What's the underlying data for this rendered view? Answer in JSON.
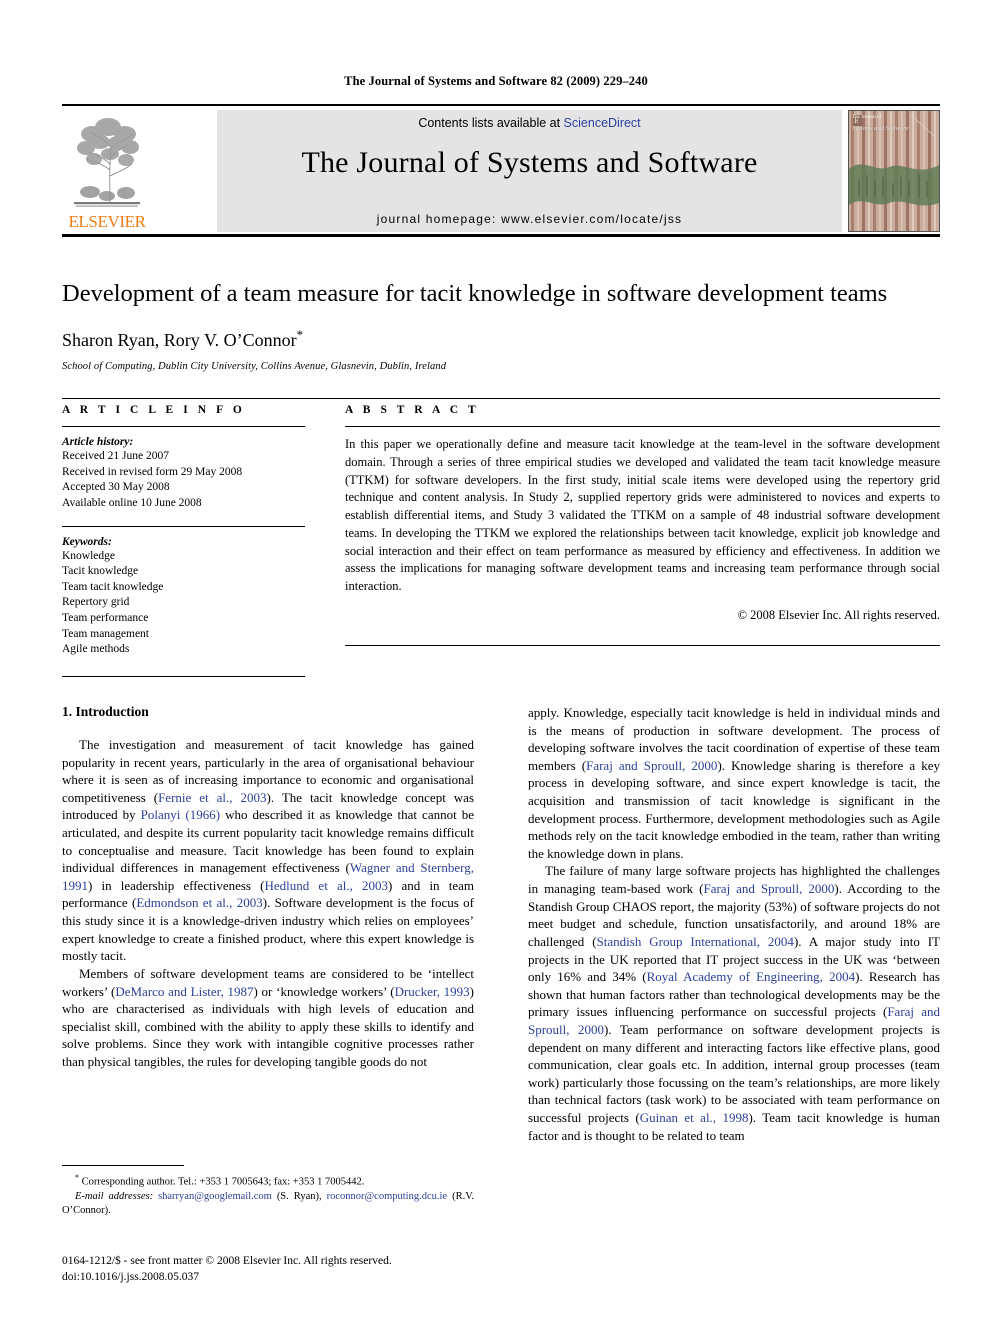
{
  "running_head": "The Journal of Systems and Software 82 (2009) 229–240",
  "masthead": {
    "contents_prefix": "Contents lists available at ",
    "sciencedirect": "ScienceDirect",
    "journal_title": "The Journal of Systems and Software",
    "homepage": "journal homepage: www.elsevier.com/locate/jss",
    "publisher_wordmark": "ELSEVIER",
    "cover": {
      "small_label": "The Journal of",
      "title": "Systems and Software"
    },
    "link_color": "#2a3fa0",
    "banner_bg": "#e4e4e4",
    "wordmark_color": "#f07c16"
  },
  "title_block": {
    "title": "Development of a team measure for tacit knowledge in software development teams",
    "authors": "Sharon Ryan, Rory V. O’Connor",
    "corresponding_marker": "*",
    "affiliation": "School of Computing, Dublin City University, Collins Avenue, Glasnevin, Dublin, Ireland"
  },
  "article_info": {
    "heading": "A R T I C L E    I N F O",
    "history_label": "Article history:",
    "history": [
      "Received 21 June 2007",
      "Received in revised form 29 May 2008",
      "Accepted 30 May 2008",
      "Available online 10 June 2008"
    ],
    "keywords_label": "Keywords:",
    "keywords": [
      "Knowledge",
      "Tacit knowledge",
      "Team tacit knowledge",
      "Repertory grid",
      "Team performance",
      "Team management",
      "Agile methods"
    ]
  },
  "abstract": {
    "heading": "A B S T R A C T",
    "text": "In this paper we operationally define and measure tacit knowledge at the team-level in the software development domain. Through a series of three empirical studies we developed and validated the team tacit knowledge measure (TTKM) for software developers. In the first study, initial scale items were developed using the repertory grid technique and content analysis. In Study 2, supplied repertory grids were administered to novices and experts to establish differential items, and Study 3 validated the TTKM on a sample of 48 industrial software development teams. In developing the TTKM we explored the relationships between tacit knowledge, explicit job knowledge and social interaction and their effect on team performance as measured by efficiency and effectiveness. In addition we assess the implications for managing software development teams and increasing team performance through social interaction.",
    "copyright": "© 2008 Elsevier Inc. All rights reserved."
  },
  "body": {
    "section_heading": "1. Introduction",
    "left_paragraphs": [
      {
        "segments": [
          {
            "t": "The investigation and measurement of tacit knowledge has gained popularity in recent years, particularly in the area of organisational behaviour where it is seen as of increasing importance to economic and organisational competitiveness (",
            "r": false
          },
          {
            "t": "Fernie et al., 2003",
            "r": true
          },
          {
            "t": "). The tacit knowledge concept was introduced by ",
            "r": false
          },
          {
            "t": "Polanyi (1966)",
            "r": true
          },
          {
            "t": " who described it as knowledge that cannot be articulated, and despite its current popularity tacit knowledge remains difficult to conceptualise and measure. Tacit knowledge has been found to explain individual differences in management effectiveness (",
            "r": false
          },
          {
            "t": "Wagner and Sternberg, 1991",
            "r": true
          },
          {
            "t": ") in leadership effectiveness (",
            "r": false
          },
          {
            "t": "Hedlund et al., 2003",
            "r": true
          },
          {
            "t": ") and in team performance (",
            "r": false
          },
          {
            "t": "Edmondson et al., 2003",
            "r": true
          },
          {
            "t": "). Software development is the focus of this study since it is a knowledge-driven industry which relies on employees’ expert knowledge to create a finished product, where this expert knowledge is mostly tacit.",
            "r": false
          }
        ]
      },
      {
        "segments": [
          {
            "t": "Members of software development teams are considered to be ‘intellect workers’ (",
            "r": false
          },
          {
            "t": "DeMarco and Lister, 1987",
            "r": true
          },
          {
            "t": ") or ‘knowledge workers’ (",
            "r": false
          },
          {
            "t": "Drucker, 1993",
            "r": true
          },
          {
            "t": ") who are characterised as individuals with high levels of education and specialist skill, combined with the ability to apply these skills to identify and solve problems. Since they work with intangible cognitive processes rather than physical tangibles, the rules for developing tangible goods do not",
            "r": false
          }
        ]
      }
    ],
    "right_paragraphs": [
      {
        "segments": [
          {
            "t": "apply. Knowledge, especially tacit knowledge is held in individual minds and is the means of production in software development. The process of developing software involves the tacit coordination of expertise of these team members (",
            "r": false
          },
          {
            "t": "Faraj and Sproull, 2000",
            "r": true
          },
          {
            "t": "). Knowledge sharing is therefore a key process in developing software, and since expert knowledge is tacit, the acquisition and transmission of tacit knowledge is significant in the development process. Furthermore, development methodologies such as Agile methods rely on the tacit knowledge embodied in the team, rather than writing the knowledge down in plans.",
            "r": false
          }
        ],
        "noindent": true
      },
      {
        "segments": [
          {
            "t": "The failure of many large software projects has highlighted the challenges in managing team-based work (",
            "r": false
          },
          {
            "t": "Faraj and Sproull, 2000",
            "r": true
          },
          {
            "t": "). According to the Standish Group CHAOS report, the majority (53%) of software projects do not meet budget and schedule, function unsatisfactorily, and around 18% are challenged (",
            "r": false
          },
          {
            "t": "Standish Group International, 2004",
            "r": true
          },
          {
            "t": "). A major study into IT projects in the UK reported that IT project success in the UK was ‘between only 16% and 34% (",
            "r": false
          },
          {
            "t": "Royal Academy of Engineering, 2004",
            "r": true
          },
          {
            "t": "). Research has shown that human factors rather than technological developments may be the primary issues influencing performance on successful projects (",
            "r": false
          },
          {
            "t": "Faraj and Sproull, 2000",
            "r": true
          },
          {
            "t": "). Team performance on software development projects is dependent on many different and interacting factors like effective plans, good communication, clear goals etc. In addition, internal group processes (team work) particularly those focussing on the team’s relationships, are more likely than technical factors (task work) to be associated with team performance on successful projects (",
            "r": false
          },
          {
            "t": "Guinan et al., 1998",
            "r": true
          },
          {
            "t": "). Team tacit knowledge is human factor and is thought to be related to team",
            "r": false
          }
        ]
      }
    ]
  },
  "footnotes": {
    "corresponding": "Corresponding author. Tel.: +353 1 7005643; fax: +353 1 7005442.",
    "email_label": "E-mail addresses:",
    "email1": "sharryan@googlemail.com",
    "email1_owner": "(S. Ryan),",
    "email2": "roconnor@computing.dcu.ie",
    "email2_owner": "(R.V. O’Connor).",
    "imprint_line1": "0164-1212/$ - see front matter © 2008 Elsevier Inc. All rights reserved.",
    "imprint_line2": "doi:10.1016/j.jss.2008.05.037"
  }
}
